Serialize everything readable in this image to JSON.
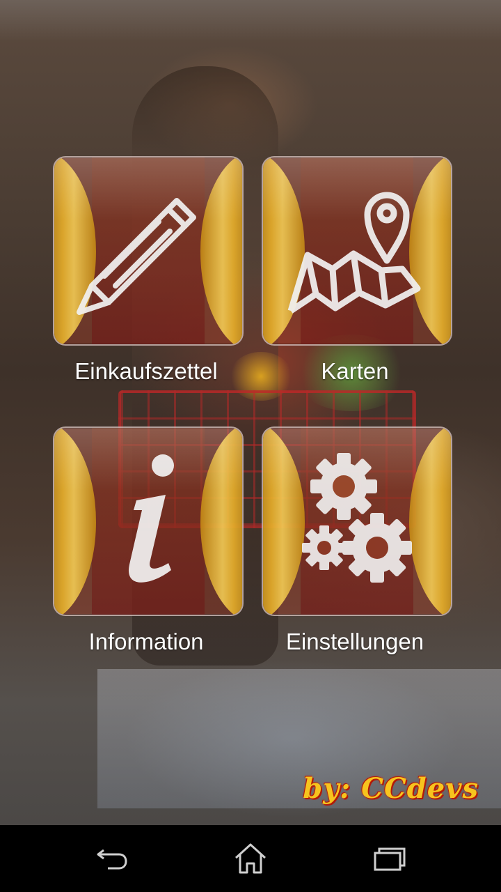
{
  "tiles": [
    {
      "label": "Einkaufszettel",
      "icon": "pencil-icon"
    },
    {
      "label": "Karten",
      "icon": "map-pin-icon"
    },
    {
      "label": "Information",
      "icon": "info-icon"
    },
    {
      "label": "Einstellungen",
      "icon": "gears-icon"
    }
  ],
  "credit": "by: CCdevs",
  "navbar": {
    "back_icon": "back-icon",
    "home_icon": "home-icon",
    "recents_icon": "recent-apps-icon"
  },
  "colors": {
    "tile_gold": "#e8b22a",
    "credit_text": "#f7c41e",
    "credit_outline": "#b01a08",
    "label_text": "#ffffff",
    "navbar": "#000000"
  }
}
